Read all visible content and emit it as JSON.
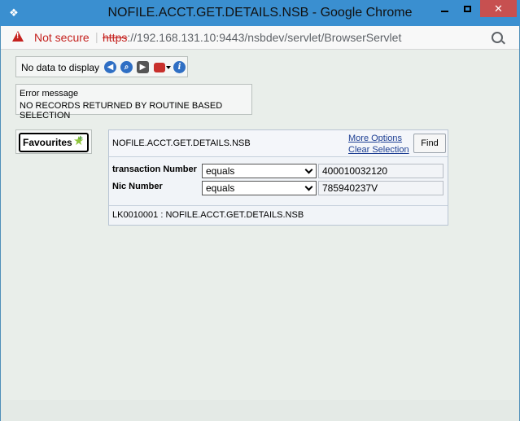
{
  "window": {
    "title": "NOFILE.ACCT.GET.DETAILS.NSB - Google Chrome",
    "app_icon": "chrome-app-icon",
    "minimize_icon": "minimize-icon",
    "maximize_icon": "maximize-icon",
    "close_icon": "close-icon",
    "close_glyph": "✕"
  },
  "addressbar": {
    "security_icon": "warning-icon",
    "security_text": "Not secure",
    "separator": "|",
    "url_scheme": "https",
    "url_rest": "://192.168.131.10:9443/nsbdev/servlet/BrowserServlet",
    "zoom_icon": "zoom-icon"
  },
  "toolbar": {
    "status_text": "No data to display",
    "icons": [
      "back-icon",
      "search-icon",
      "next-icon",
      "tools-icon",
      "info-icon"
    ],
    "info_glyph": "i"
  },
  "error": {
    "heading": "Error message",
    "message": "NO RECORDS RETURNED BY ROUTINE BASED SELECTION"
  },
  "favourites": {
    "label": "Favourites",
    "icon": "add-favourite-icon"
  },
  "selection": {
    "title": "NOFILE.ACCT.GET.DETAILS.NSB",
    "more_options": "More Options",
    "clear_selection": "Clear Selection",
    "find_label": "Find",
    "rows": [
      {
        "label": "transaction Number",
        "operator": "equals",
        "value": "400010032120"
      },
      {
        "label": "Nic Number",
        "operator": "equals",
        "value": "785940237V"
      }
    ],
    "footer": "LK0010001 : NOFILE.ACCT.GET.DETAILS.NSB"
  },
  "colors": {
    "titlebar": "#3a8fd0",
    "close_button": "#c75050",
    "not_secure": "#c5221f",
    "page_background": "#e9eeea",
    "link": "#1d3f93"
  }
}
